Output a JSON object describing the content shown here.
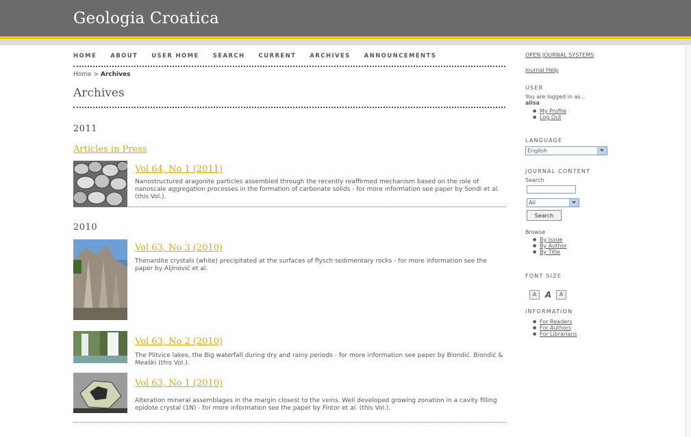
{
  "header": {
    "title": "Geologia Croatica"
  },
  "nav": {
    "items": [
      "HOME",
      "ABOUT",
      "USER HOME",
      "SEARCH",
      "CURRENT",
      "ARCHIVES",
      "ANNOUNCEMENTS"
    ]
  },
  "breadcrumb": {
    "home": "Home",
    "separator": ">",
    "current": "Archives"
  },
  "page": {
    "title": "Archives"
  },
  "archives": {
    "year_2011": "2011",
    "articles_in_press": "Articles in Press",
    "year_2010": "2010",
    "issues": [
      {
        "title": "Vol 64, No 1 (2011)",
        "description": "Nanostructured aragonite particles assembled through the recently reaffirmed mechanism based on the role of nanoscale aggregation processes in the formation of carbonate solids - for more information see paper by Sondi et al. (this Vol.)."
      },
      {
        "title": "Vol 63, No 3 (2010)",
        "description": "Thenardite crystals (white) precipitated at the surfaces of flysch sedimentary rocks - for more information see the paper by Aljinović et al."
      },
      {
        "title": "Vol 63, No 2 (2010)",
        "description": "The Plitvice lakes, the Big waterfall during dry and rainy periods - for more information see paper by Biondić. Biondić & Meaški (this Vol.)."
      },
      {
        "title": "Vol 63, No 1 (2010)",
        "description": "Alteration mineral assemblages in the margin closest to the veins. Well developed growing zonation in a cavity filling epidote crystal (1N) - for more information see the paper by Fintor et al. (this Vol.)."
      }
    ]
  },
  "sidebar": {
    "ojs_link": "OPEN JOURNAL SYSTEMS",
    "journal_help": "Journal Help",
    "user_heading": "USER",
    "logged_in_as": "You are logged in as...",
    "username": "alisa",
    "my_profile": "My Profile",
    "log_out": "Log Out",
    "language_heading": "LANGUAGE",
    "language_value": "English",
    "journal_content_heading": "JOURNAL CONTENT",
    "search_label": "Search",
    "search_scope_value": "All",
    "search_button": "Search",
    "browse_label": "Browse",
    "browse_items": [
      "By Issue",
      "By Author",
      "By Title"
    ],
    "font_size_heading": "FONT SIZE",
    "font_buttons": [
      "A",
      "A",
      "A"
    ],
    "information_heading": "INFORMATION",
    "information_items": [
      "For Readers",
      "For Authors",
      "For Librarians"
    ]
  },
  "colors": {
    "header_bg": "#6b6b6b",
    "accent_gold": "#f1c400",
    "link_gold": "#e0a800"
  }
}
